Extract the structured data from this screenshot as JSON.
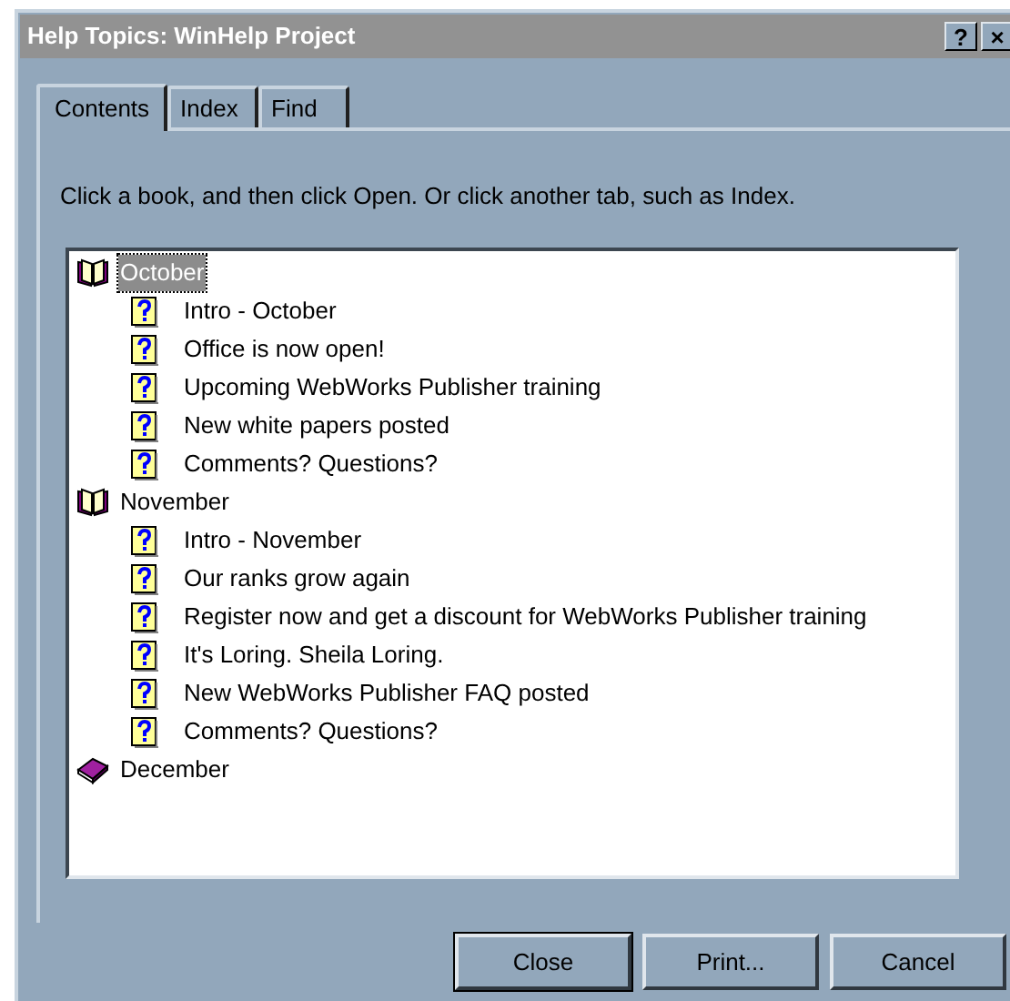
{
  "window": {
    "title": "Help Topics: WinHelp Project",
    "title_buttons": [
      "?",
      "×"
    ]
  },
  "tabs": [
    {
      "label": "Contents",
      "selected": true
    },
    {
      "label": "Index",
      "selected": false
    },
    {
      "label": "Find",
      "selected": false
    }
  ],
  "instructions": "Click a book, and then click Open. Or click another tab, such as Index.",
  "tree": [
    {
      "label": "October",
      "expanded": true,
      "selected": true,
      "children": [
        {
          "label": "Intro - October",
          "selected": false
        },
        {
          "label": "Office is now open!",
          "selected": false
        },
        {
          "label": "Upcoming WebWorks Publisher training",
          "selected": false
        },
        {
          "label": "New white papers posted",
          "selected": false
        },
        {
          "label": "Comments? Questions?",
          "selected": false
        }
      ]
    },
    {
      "label": "November",
      "expanded": true,
      "selected": false,
      "children": [
        {
          "label": "Intro - November",
          "selected": false
        },
        {
          "label": "Our ranks grow again",
          "selected": false
        },
        {
          "label": "Register now and get a discount for WebWorks Publisher training",
          "selected": false
        },
        {
          "label": "It's Loring. Sheila Loring.",
          "selected": false
        },
        {
          "label": "New WebWorks Publisher FAQ posted",
          "selected": false
        },
        {
          "label": "Comments? Questions?",
          "selected": false
        }
      ]
    },
    {
      "label": "December",
      "expanded": false,
      "selected": false
    }
  ],
  "buttons": [
    {
      "label": "Close",
      "default": true
    },
    {
      "label": "Print...",
      "default": false
    },
    {
      "label": "Cancel",
      "default": false
    }
  ]
}
